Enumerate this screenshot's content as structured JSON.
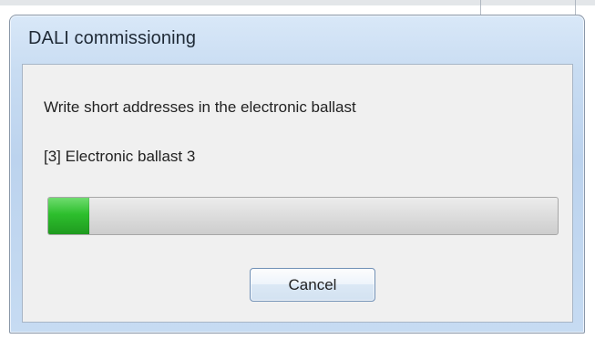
{
  "window": {
    "title": "DALI commissioning"
  },
  "dialog": {
    "message": "Write short addresses in the electronic ballast",
    "current_item": "[3] Electronic ballast 3",
    "progress_fraction": 0.08,
    "cancel_label": "Cancel"
  },
  "colors": {
    "title_bar": "#c8dcf2",
    "client_area": "#f0f0f0",
    "progress_fill": "#2dbf2d",
    "progress_track": "#dedede",
    "button_border": "#6f8fb5"
  },
  "icons": {}
}
